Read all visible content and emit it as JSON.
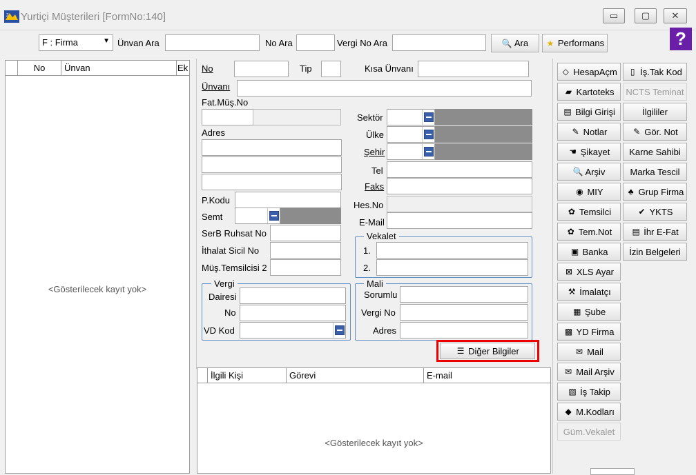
{
  "window": {
    "title": "Yurtiçi Müşterileri [FormNo:140]",
    "min": "▭",
    "max": "▢",
    "close": "✕"
  },
  "toolbar": {
    "type_select": "F : Firma",
    "unvan_ara": "Ünvan Ara",
    "no_ara": "No Ara",
    "vergi_no_ara": "Vergi No Ara",
    "ara_button": "Ara",
    "performans_button": "Performans",
    "help_icon": "?"
  },
  "left_list": {
    "columns": [
      "No",
      "Ünvan",
      "Ek"
    ],
    "empty": "<Gösterilecek kayıt yok>"
  },
  "form": {
    "no": "No",
    "tip": "Tip",
    "kisa_unvani": "Kısa Ünvanı",
    "unvani": "Ünvanı",
    "fat_mus_no": "Fat.Müş.No",
    "adres": "Adres",
    "sektor": "Sektör",
    "ulke": "Ülke",
    "sehir": "Şehir",
    "tel": "Tel",
    "faks": "Faks",
    "hes_no": "Hes.No",
    "email": "E-Mail",
    "pkodu": "P.Kodu",
    "semt": "Semt",
    "serb_ruhsat": "SerB Ruhsat No",
    "ithalat_sicil": "İthalat Sicil No",
    "mus_temsilcisi": "Müş.Temsilcisi 2",
    "vekalet": {
      "title": "Vekalet",
      "row1": "1.",
      "row2": "2."
    },
    "vergi": {
      "title": "Vergi",
      "dairesi": "Dairesi",
      "no": "No",
      "vd_kod": "VD Kod"
    },
    "mali": {
      "title": "Mali",
      "sorumlu": "Sorumlu",
      "vergi_no": "Vergi No",
      "adres": "Adres"
    },
    "diger_bilgiler": "Diğer Bilgiler"
  },
  "contacts": {
    "columns": [
      "İlgili Kişi",
      "Görevi",
      "E-mail"
    ],
    "empty": "<Gösterilecek kayıt yok>"
  },
  "side_buttons_col1": [
    {
      "label": "HesapAçm",
      "icon": "◇",
      "enabled": true
    },
    {
      "label": "Kartoteks",
      "icon": "▰",
      "enabled": true
    },
    {
      "label": "Bilgi Girişi",
      "icon": "▤",
      "enabled": true
    },
    {
      "label": "Notlar",
      "icon": "✎",
      "enabled": true
    },
    {
      "label": "Şikayet",
      "icon": "☚",
      "enabled": true
    },
    {
      "label": "Arşiv",
      "icon": "🔍",
      "enabled": true
    },
    {
      "label": "MIY",
      "icon": "◉",
      "enabled": true
    },
    {
      "label": "Temsilci",
      "icon": "✿",
      "enabled": true
    },
    {
      "label": "Tem.Not",
      "icon": "✿",
      "enabled": true
    },
    {
      "label": "Banka",
      "icon": "▣",
      "enabled": true
    },
    {
      "label": "XLS Ayar",
      "icon": "⊠",
      "enabled": true
    },
    {
      "label": "İmalatçı",
      "icon": "⚒",
      "enabled": true
    },
    {
      "label": "Şube",
      "icon": "▦",
      "enabled": true
    },
    {
      "label": "YD Firma",
      "icon": "▩",
      "enabled": true
    },
    {
      "label": "Mail",
      "icon": "✉",
      "enabled": true
    },
    {
      "label": "Mail Arşiv",
      "icon": "✉",
      "enabled": true
    },
    {
      "label": "İş Takip",
      "icon": "▧",
      "enabled": true
    },
    {
      "label": "M.Kodları",
      "icon": "◆",
      "enabled": true
    },
    {
      "label": "Güm.Vekalet",
      "icon": "",
      "enabled": false
    }
  ],
  "side_buttons_col2": [
    {
      "label": "İş.Tak Kod",
      "icon": "▯",
      "enabled": true
    },
    {
      "label": "NCTS Teminat",
      "icon": "",
      "enabled": false
    },
    {
      "label": "İlgililer",
      "icon": "",
      "enabled": true
    },
    {
      "label": "Gör. Not",
      "icon": "✎",
      "enabled": true
    },
    {
      "label": "Karne Sahibi",
      "icon": "",
      "enabled": true
    },
    {
      "label": "Marka Tescil",
      "icon": "",
      "enabled": true
    },
    {
      "label": "Grup Firma",
      "icon": "♣",
      "enabled": true
    },
    {
      "label": "YKTS",
      "icon": "✔",
      "enabled": true
    },
    {
      "label": "İhr E-Fat",
      "icon": "▤",
      "enabled": true
    },
    {
      "label": "İzin Belgeleri",
      "icon": "",
      "enabled": true
    }
  ],
  "colors": {
    "accent_blue": "#3a5ea8",
    "highlight_red": "#e00000",
    "disabled_field": "#8c8c8c"
  }
}
